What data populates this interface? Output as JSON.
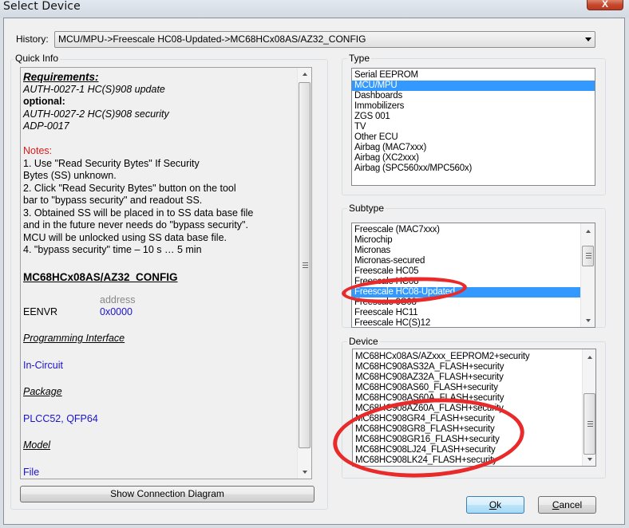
{
  "window": {
    "title": "Select Device",
    "close_label": "X"
  },
  "history": {
    "label": "History:",
    "value": "MCU/MPU->Freescale HC08-Updated->MC68HCx08AS/AZ32_CONFIG"
  },
  "quick_info": {
    "title": "Quick Info",
    "requirements_heading": "Requirements:",
    "req_line1": "AUTH-0027-1 HC(S)908  update",
    "optional_label": "optional:",
    "opt_line1": "AUTH-0027-2 HC(S)908  security",
    "opt_line2": "ADP-0017",
    "notes_heading": "Notes:",
    "notes": [
      "1. Use \"Read Security Bytes\" If Security",
      "Bytes (SS) unknown.",
      "2. Click \"Read Security Bytes\" button on the tool",
      "bar to \"bypass security\" and readout SS.",
      "3. Obtained SS will be placed in to SS data base file",
      "and in the future never needs do \"bypass security\".",
      "MCU will be unlocked using SS data base file.",
      "4. \"bypass security\" time – 10 s … 5 min"
    ],
    "config_heading": "MC68HCx08AS/AZ32_CONFIG",
    "address_header": "address",
    "register_name": "EENVR",
    "register_address": "0x0000",
    "prog_interface_heading": "Programming Interface",
    "prog_interface_value": "In-Circuit",
    "package_heading": "Package",
    "package_value": "PLCC52, QFP64",
    "model_heading": "Model",
    "model_value": "File"
  },
  "show_diagram_button": "Show Connection Diagram",
  "type": {
    "title": "Type",
    "items": [
      {
        "label": "Serial EEPROM",
        "selected": false
      },
      {
        "label": "MCU/MPU",
        "selected": true
      },
      {
        "label": "Dashboards",
        "selected": false
      },
      {
        "label": "Immobilizers",
        "selected": false
      },
      {
        "label": "ZGS 001",
        "selected": false
      },
      {
        "label": "TV",
        "selected": false
      },
      {
        "label": "Other ECU",
        "selected": false
      },
      {
        "label": "Airbag (MAC7xxx)",
        "selected": false
      },
      {
        "label": "Airbag (XC2xxx)",
        "selected": false
      },
      {
        "label": "Airbag (SPC560xx/MPC560x)",
        "selected": false
      }
    ]
  },
  "subtype": {
    "title": "Subtype",
    "items": [
      {
        "label": "Freescale (MAC7xxx)",
        "selected": false
      },
      {
        "label": "Microchip",
        "selected": false
      },
      {
        "label": "Micronas",
        "selected": false
      },
      {
        "label": "Micronas-secured",
        "selected": false
      },
      {
        "label": "Freescale HC05",
        "selected": false
      },
      {
        "label": "Freescale HC08",
        "selected": false
      },
      {
        "label": "Freescale HC08-Updated",
        "selected": true
      },
      {
        "label": "Freescale 9S08",
        "selected": false
      },
      {
        "label": "Freescale HC11",
        "selected": false
      },
      {
        "label": "Freescale HC(S)12",
        "selected": false
      }
    ]
  },
  "device": {
    "title": "Device",
    "items": [
      {
        "label": "MC68HCx08AS/AZxxx_EEPROM2+security",
        "selected": false
      },
      {
        "label": "MC68HC908AS32A_FLASH+security",
        "selected": false
      },
      {
        "label": "MC68HC908AZ32A_FLASH+security",
        "selected": false
      },
      {
        "label": "MC68HC908AS60_FLASH+security",
        "selected": false
      },
      {
        "label": "MC68HC908AS60A_FLASH+security",
        "selected": false
      },
      {
        "label": "MC68HC908AZ60A_FLASH+security",
        "selected": false
      },
      {
        "label": "MC68HC908GR4_FLASH+security",
        "selected": false
      },
      {
        "label": "MC68HC908GR8_FLASH+security",
        "selected": false
      },
      {
        "label": "MC68HC908GR16_FLASH+security",
        "selected": false
      },
      {
        "label": "MC68HC908LJ24_FLASH+security",
        "selected": false
      },
      {
        "label": "MC68HC908LK24_FLASH+security",
        "selected": false
      }
    ]
  },
  "buttons": {
    "ok_label": "Ok",
    "ok_mnemonic": "O",
    "cancel_label": "Cancel",
    "cancel_mnemonic": "C"
  },
  "colors": {
    "selection": "#3399ff",
    "annotation": "#e82a2a",
    "notes_red": "#e01a1a",
    "value_blue": "#1a14c8"
  }
}
